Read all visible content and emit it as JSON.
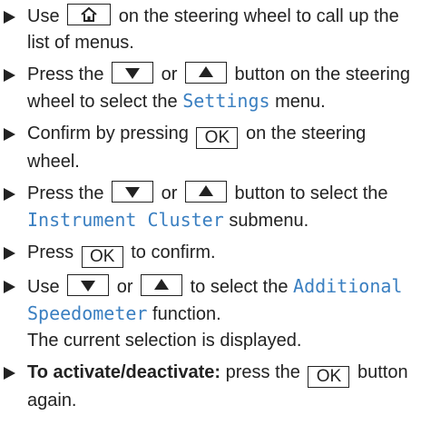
{
  "steps": [
    {
      "pre": "Use",
      "post": "on the steering wheel to call up the list of menus."
    },
    {
      "pre": "Press the",
      "or": "or",
      "post": "button on the steering wheel to select the",
      "menu": "Settings",
      "post2": "menu."
    },
    {
      "pre": "Confirm by pressing",
      "post": "on the steering wheel."
    },
    {
      "pre": "Press the",
      "or": "or",
      "post": "button to select the",
      "menu": "Instrument Cluster",
      "post2": "submenu."
    },
    {
      "pre": "Press",
      "post": "to confirm."
    },
    {
      "pre": "Use",
      "or": "or",
      "post": "to select the",
      "menu": "Additional Speedometer",
      "post2": "function.",
      "note": "The current selection is displayed."
    },
    {
      "bold": "To activate/deactivate:",
      "pre": "press the",
      "post": "button again."
    }
  ],
  "buttons": {
    "ok_label": "OK",
    "home_icon": "home-icon",
    "down_icon": "triangle-down-icon",
    "up_icon": "triangle-up-icon"
  },
  "colors": {
    "menu_text": "#3a7fc1",
    "text": "#222222"
  }
}
